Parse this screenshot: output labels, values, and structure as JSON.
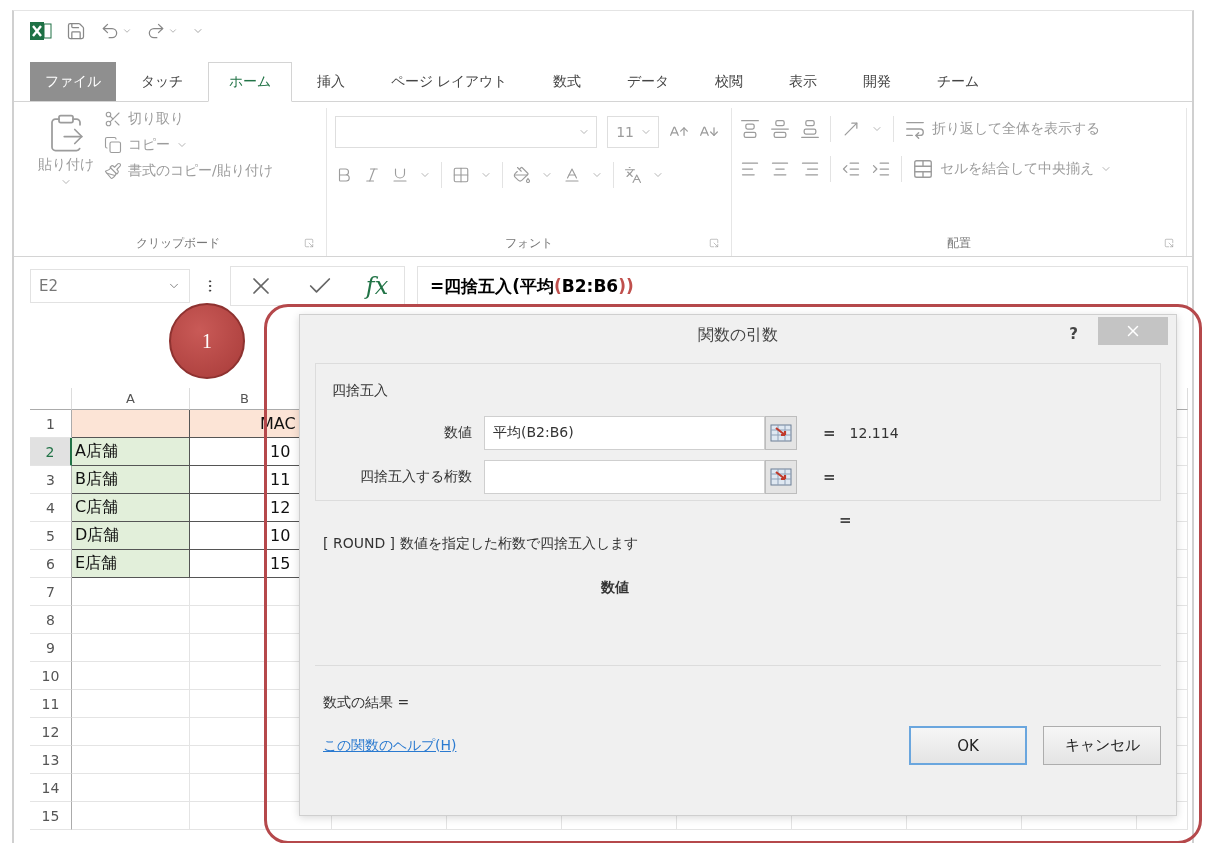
{
  "tabs": [
    {
      "label": "ファイル",
      "kind": "file",
      "selected": false
    },
    {
      "label": "タッチ",
      "kind": "tab",
      "selected": false
    },
    {
      "label": "ホーム",
      "kind": "tab",
      "selected": true
    },
    {
      "label": "挿入",
      "kind": "tab",
      "selected": false
    },
    {
      "label": "ページ レイアウト",
      "kind": "tab",
      "selected": false
    },
    {
      "label": "数式",
      "kind": "tab",
      "selected": false
    },
    {
      "label": "データ",
      "kind": "tab",
      "selected": false
    },
    {
      "label": "校閲",
      "kind": "tab",
      "selected": false
    },
    {
      "label": "表示",
      "kind": "tab",
      "selected": false
    },
    {
      "label": "開発",
      "kind": "tab",
      "selected": false
    },
    {
      "label": "チーム",
      "kind": "tab",
      "selected": false
    }
  ],
  "ribbon": {
    "disabled": true,
    "groups": [
      {
        "kind": "clipboard",
        "label": "クリップボード",
        "paste_label": "貼り付け",
        "commands": [
          {
            "kind": "cut",
            "label": "切り取り"
          },
          {
            "kind": "copy",
            "label": "コピー"
          },
          {
            "kind": "format_painter",
            "label": "書式のコピー/貼り付け"
          }
        ]
      },
      {
        "kind": "font",
        "label": "フォント",
        "font_size": "11"
      },
      {
        "kind": "alignment",
        "label": "配置",
        "commands": [
          {
            "kind": "wrap",
            "label": "折り返して全体を表示する"
          },
          {
            "kind": "merge",
            "label": "セルを結合して中央揃え"
          }
        ]
      }
    ]
  },
  "formula_bar": {
    "name_box": "E2",
    "function_label": "fx",
    "formula": [
      {
        "text": "=四捨五入(平均",
        "color": "#000000"
      },
      {
        "text": "(",
        "color": "#c0504d"
      },
      {
        "text": "B2:B6",
        "color": "#000000"
      },
      {
        "text": "))",
        "color": "#c0504d"
      }
    ]
  },
  "sheet": {
    "columns": [
      "A",
      "B"
    ],
    "rows": [
      {
        "number": "1",
        "kind": "header",
        "selected": false,
        "column_b": "MAC"
      },
      {
        "number": "2",
        "kind": "data",
        "selected": true,
        "column_a": "A店舗",
        "column_b": "10"
      },
      {
        "number": "3",
        "kind": "data",
        "selected": false,
        "column_a": "B店舗",
        "column_b": "11"
      },
      {
        "number": "4",
        "kind": "data",
        "selected": false,
        "column_a": "C店舗",
        "column_b": "12"
      },
      {
        "number": "5",
        "kind": "data",
        "selected": false,
        "column_a": "D店舗",
        "column_b": "10"
      },
      {
        "number": "6",
        "kind": "data",
        "selected": false,
        "column_a": "E店舗",
        "column_b": "15"
      },
      {
        "number": "7",
        "kind": "empty",
        "selected": false
      },
      {
        "number": "8",
        "kind": "empty",
        "selected": false
      },
      {
        "number": "9",
        "kind": "empty",
        "selected": false
      },
      {
        "number": "10",
        "kind": "empty",
        "selected": false
      },
      {
        "number": "11",
        "kind": "empty",
        "selected": false
      },
      {
        "number": "12",
        "kind": "empty",
        "selected": false
      },
      {
        "number": "13",
        "kind": "empty",
        "selected": false
      },
      {
        "number": "14",
        "kind": "empty",
        "selected": false
      },
      {
        "number": "15",
        "kind": "empty",
        "selected": false
      }
    ]
  },
  "callout": {
    "label": "1"
  },
  "dialog": {
    "title": "関数の引数",
    "help": "?",
    "group_title": "四捨五入",
    "arguments": [
      {
        "label": "数値",
        "value": "平均(B2:B6)",
        "equals": "=",
        "result": "12.114"
      },
      {
        "label": "四捨五入する桁数",
        "equals": "="
      }
    ],
    "function_equals": "=",
    "description": "[ ROUND ] 数値を指定した桁数で四捨五入します",
    "argument_name": "数値",
    "formula_result": "数式の結果 =",
    "help_link": "この関数のヘルプ(H)",
    "buttons": [
      {
        "label": "OK",
        "focused": true
      },
      {
        "label": "キャンセル",
        "focused": false
      }
    ]
  }
}
